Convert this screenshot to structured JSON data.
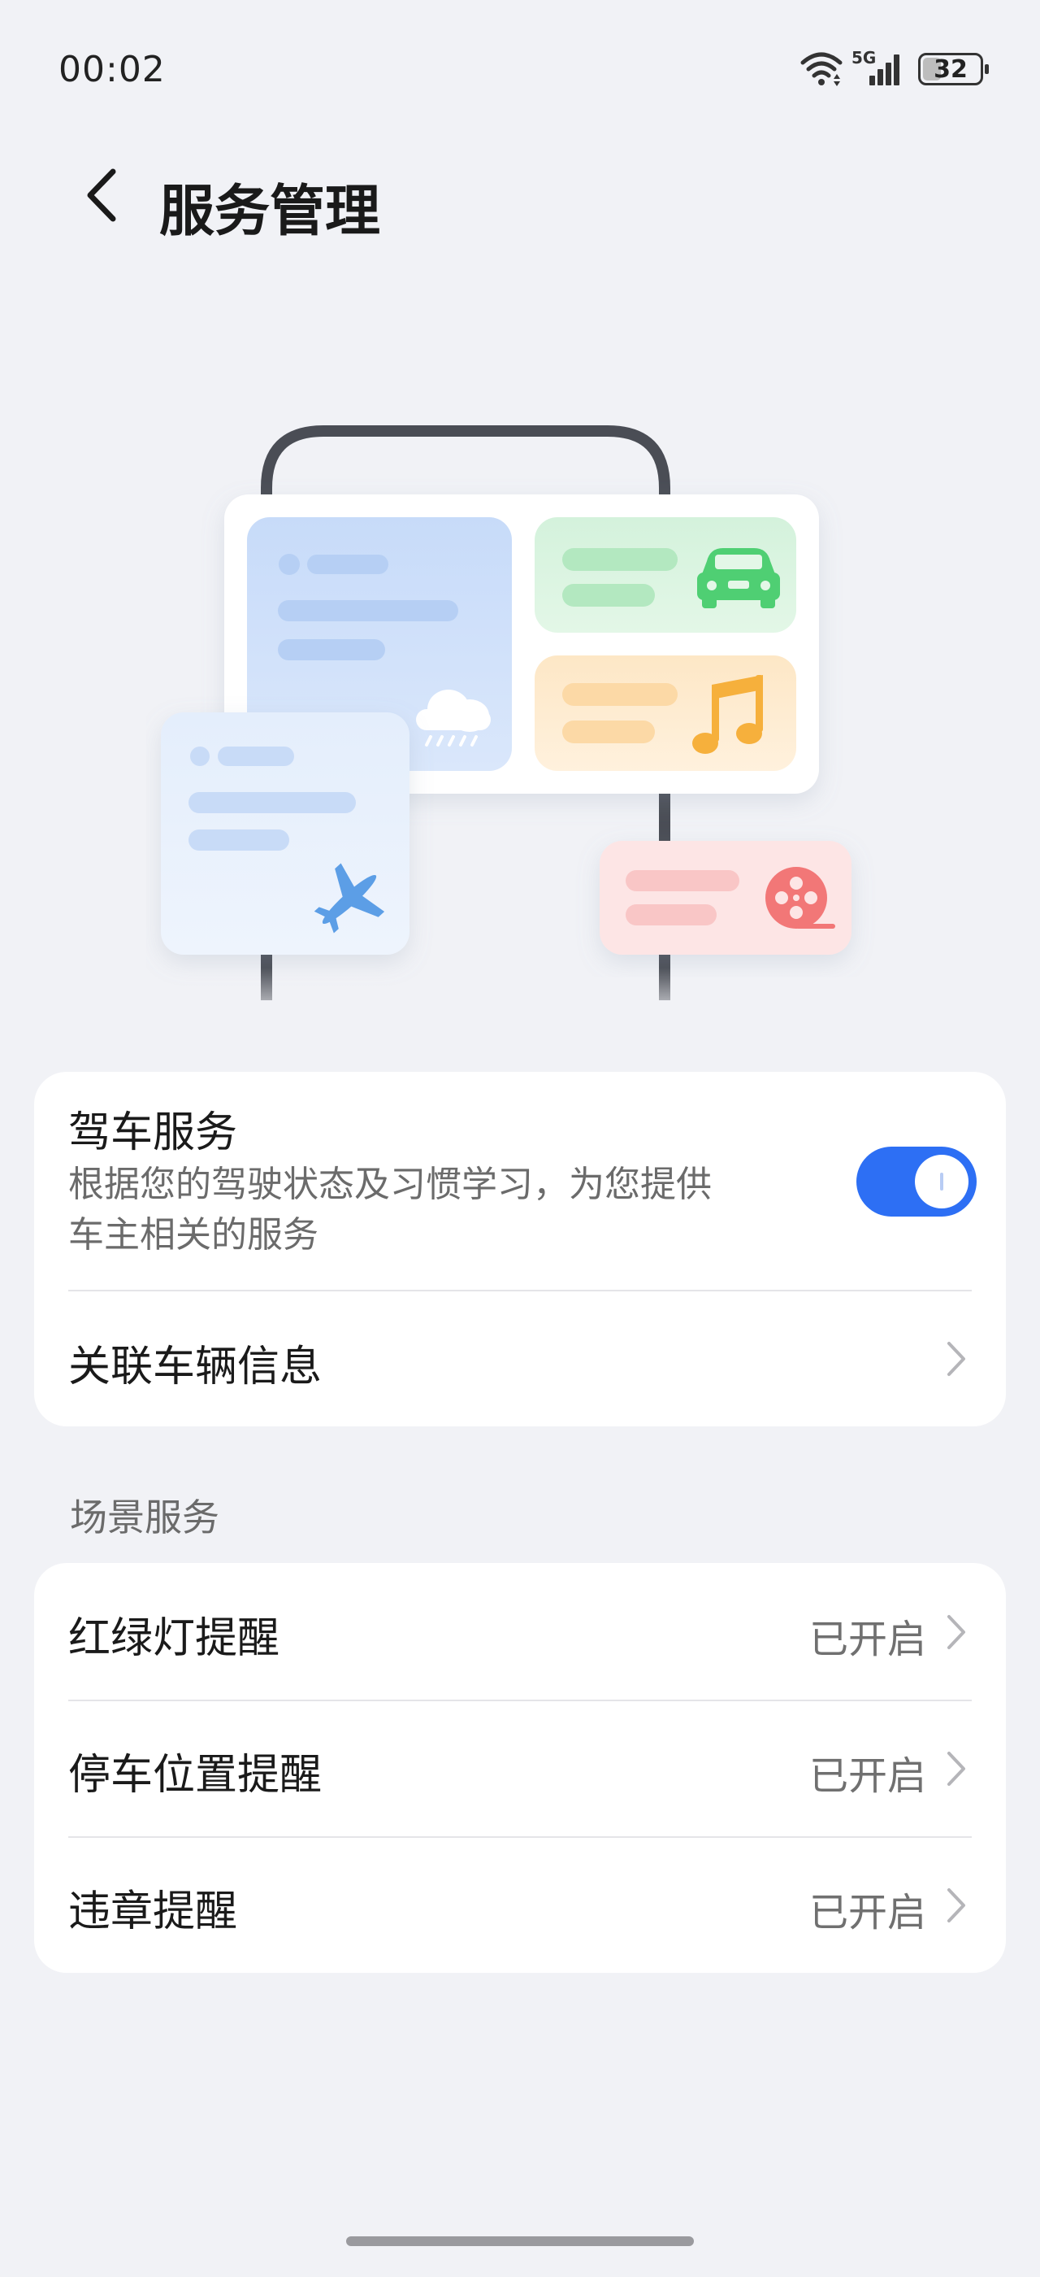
{
  "status_bar": {
    "time": "00:02",
    "network": "5G",
    "battery": "32",
    "battery_level": 0.32
  },
  "header": {
    "title": "服务管理"
  },
  "illustration": {
    "icons": [
      "cloud-rain-icon",
      "car-icon",
      "music-note-icon",
      "airplane-icon",
      "film-reel-icon"
    ]
  },
  "driving": {
    "title": "驾车服务",
    "desc_line1": "根据您的驾驶状态及习惯学习，为您提供",
    "desc_line2": "车主相关的服务",
    "toggle_on": true,
    "linked_vehicle": "关联车辆信息"
  },
  "scene": {
    "section_label": "场景服务",
    "items": [
      {
        "label": "红绿灯提醒",
        "status": "已开启"
      },
      {
        "label": "停车位置提醒",
        "status": "已开启"
      },
      {
        "label": "违章提醒",
        "status": "已开启"
      }
    ]
  },
  "colors": {
    "accent": "#2d6ff4",
    "background": "#f1f2f6",
    "card": "#ffffff"
  }
}
